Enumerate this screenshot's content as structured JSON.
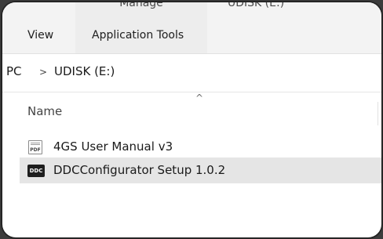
{
  "ribbon": {
    "context_group_title": "Manage",
    "peek_label": "UDISK (E:)",
    "tabs": [
      {
        "label": "View"
      },
      {
        "label": "Application Tools"
      }
    ]
  },
  "address": {
    "pc_label": "PC",
    "separator": ">",
    "drive_label": "UDISK (E:)"
  },
  "columns": {
    "name_label": "Name",
    "sort_indicator": "^"
  },
  "files": [
    {
      "icon": "pdf-file-icon",
      "icon_text": "PDF",
      "name": "4GS User Manual v3",
      "selected": false
    },
    {
      "icon": "ddc-app-icon",
      "icon_text": "DDC",
      "name": "DDCConfigurator Setup 1.0.2",
      "selected": true
    }
  ],
  "colors": {
    "selection": "#e5e5e5",
    "ribbon_bg": "#f3f3f3",
    "frame": "#3c3c3c"
  }
}
